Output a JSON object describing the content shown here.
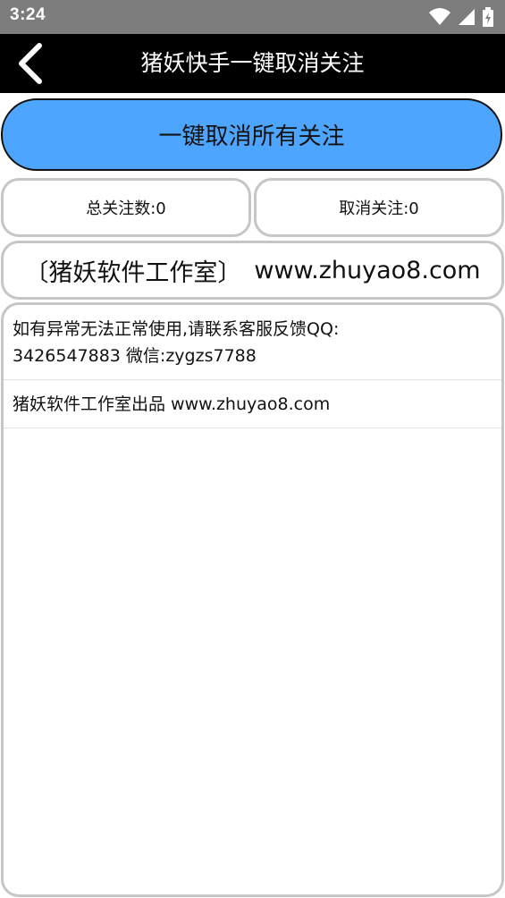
{
  "status_bar": {
    "time": "3:24",
    "icons": [
      "wifi-icon",
      "signal-icon",
      "battery-icon"
    ]
  },
  "app_bar": {
    "title": "猪妖快手一键取消关注",
    "back_icon": "chevron-left-icon"
  },
  "actions": {
    "cancel_all_label": "一键取消所有关注"
  },
  "stats": {
    "total_label": "总关注数:0",
    "cancelled_label": "取消关注:0"
  },
  "brand": {
    "studio": "〔猪妖软件工作室〕",
    "website": "www.zhuyao8.com"
  },
  "info_list": {
    "items": [
      {
        "line1": "如有异常无法正常使用,请联系客服反馈QQ:",
        "line2": "3426547883 微信:zygzs7788"
      },
      {
        "text": "猪妖软件工作室出品 www.zhuyao8.com"
      }
    ]
  },
  "colors": {
    "status_bar": "#7d7d7d",
    "app_bar": "#000000",
    "accent_button": "#4ea5fd",
    "box_border": "#c6c6c6"
  }
}
